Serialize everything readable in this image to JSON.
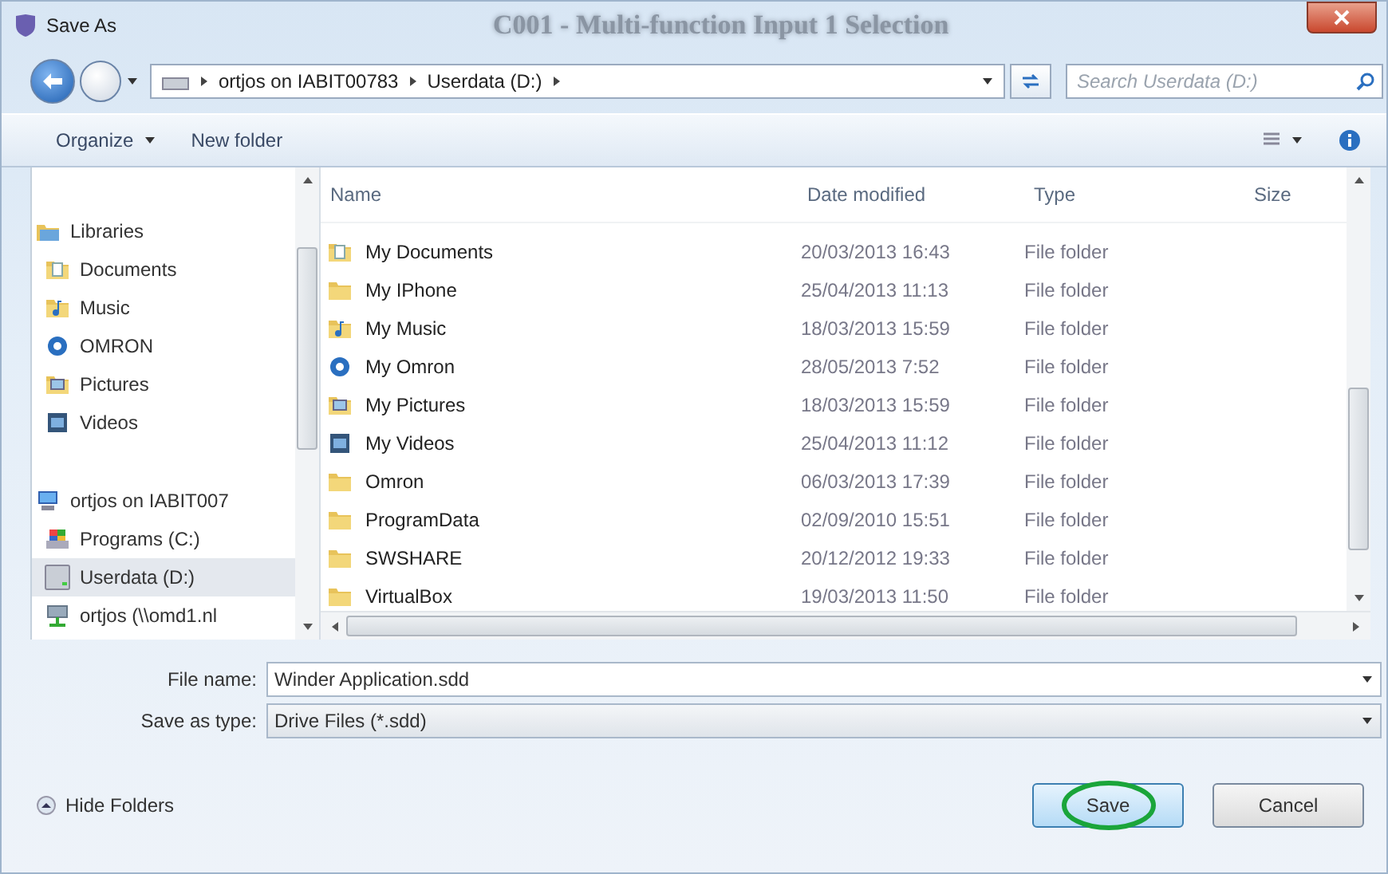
{
  "window": {
    "title": "Save As",
    "background_title": "C001 - Multi-function Input 1 Selection"
  },
  "address_bar": {
    "path": [
      "ortjos on IABIT00783",
      "Userdata (D:)"
    ]
  },
  "search": {
    "placeholder": "Search Userdata (D:)"
  },
  "toolbar": {
    "buttons": [
      {
        "label": "Organize",
        "dropdown": true
      },
      {
        "label": "New folder",
        "dropdown": false
      }
    ]
  },
  "sidebar": {
    "items": [
      {
        "label": "Libraries",
        "kind": "libraries",
        "selected": false,
        "children": [
          {
            "label": "Documents",
            "kind": "documents",
            "selected": false
          },
          {
            "label": "Music",
            "kind": "music",
            "selected": false
          },
          {
            "label": "OMRON",
            "kind": "omron",
            "selected": false
          },
          {
            "label": "Pictures",
            "kind": "pictures",
            "selected": false
          },
          {
            "label": "Videos",
            "kind": "videos",
            "selected": false
          }
        ]
      },
      {
        "label": "ortjos on IABIT007",
        "kind": "computer",
        "selected": false,
        "children": [
          {
            "label": "Programs (C:)",
            "kind": "system-drive",
            "selected": false
          },
          {
            "label": "Userdata (D:)",
            "kind": "drive",
            "selected": true
          },
          {
            "label": "ortjos (\\\\omd1.nl",
            "kind": "network-drive",
            "selected": false
          }
        ]
      }
    ]
  },
  "file_list": {
    "columns": [
      "Name",
      "Date modified",
      "Type",
      "Size"
    ],
    "rows": [
      {
        "name": "My Documents",
        "kind": "documents",
        "date": "20/03/2013 16:43",
        "type": "File folder"
      },
      {
        "name": "My IPhone",
        "kind": "folder",
        "date": "25/04/2013 11:13",
        "type": "File folder"
      },
      {
        "name": "My Music",
        "kind": "music",
        "date": "18/03/2013 15:59",
        "type": "File folder"
      },
      {
        "name": "My Omron",
        "kind": "omron",
        "date": "28/05/2013 7:52",
        "type": "File folder"
      },
      {
        "name": "My Pictures",
        "kind": "pictures",
        "date": "18/03/2013 15:59",
        "type": "File folder"
      },
      {
        "name": "My Videos",
        "kind": "videos",
        "date": "25/04/2013 11:12",
        "type": "File folder"
      },
      {
        "name": "Omron",
        "kind": "folder",
        "date": "06/03/2013 17:39",
        "type": "File folder"
      },
      {
        "name": "ProgramData",
        "kind": "folder",
        "date": "02/09/2010 15:51",
        "type": "File folder"
      },
      {
        "name": "SWSHARE",
        "kind": "folder",
        "date": "20/12/2012 19:33",
        "type": "File folder"
      },
      {
        "name": "VirtualBox",
        "kind": "folder",
        "date": "19/03/2013 11:50",
        "type": "File folder"
      }
    ]
  },
  "file_name": {
    "label": "File name:",
    "value": "Winder Application.sdd"
  },
  "save_type": {
    "label": "Save as type:",
    "value": "Drive Files (*.sdd)"
  },
  "hide_folders": {
    "label": "Hide Folders"
  },
  "buttons": [
    {
      "label": "Save",
      "default": true,
      "circled": true
    },
    {
      "label": "Cancel",
      "default": false,
      "circled": false
    }
  ]
}
